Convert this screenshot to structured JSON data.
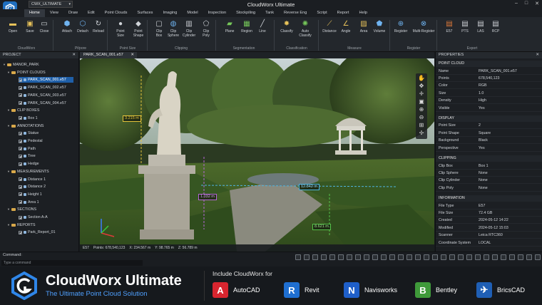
{
  "app": {
    "title": "CloudWorx Ultimate",
    "workspace": "CWX_ULTIMATE"
  },
  "menu": [
    "Home",
    "View",
    "Draw",
    "Edit",
    "Point Clouds",
    "Surfaces",
    "Imaging",
    "Model",
    "Inspection",
    "Stockpiling",
    "Tank",
    "Reverse Eng",
    "Script",
    "Report",
    "Help"
  ],
  "ribbon": {
    "buttons": [
      {
        "label": "Open",
        "icon": "folder-open-icon",
        "glyph": "▬"
      },
      {
        "label": "Save",
        "icon": "save-icon",
        "glyph": "▣"
      },
      {
        "label": "Close",
        "icon": "close-file-icon",
        "glyph": "▭"
      },
      {
        "label": "Attach",
        "icon": "attach-icon",
        "glyph": "⬢"
      },
      {
        "label": "Detach",
        "icon": "detach-icon",
        "glyph": "⬡"
      },
      {
        "label": "Reload",
        "icon": "reload-icon",
        "glyph": "↻"
      },
      {
        "label": "Point\nSize",
        "icon": "point-size-icon",
        "glyph": "●"
      },
      {
        "label": "Point\nShape",
        "icon": "point-shape-icon",
        "glyph": "◆"
      },
      {
        "label": "Clip\nBox",
        "icon": "clip-box-icon",
        "glyph": "▢"
      },
      {
        "label": "Clip\nSphere",
        "icon": "clip-sphere-icon",
        "glyph": "◍"
      },
      {
        "label": "Clip\nCylinder",
        "icon": "clip-cylinder-icon",
        "glyph": "▥"
      },
      {
        "label": "Clip\nPoly",
        "icon": "clip-poly-icon",
        "glyph": "⬠"
      },
      {
        "label": "Plane",
        "icon": "plane-icon",
        "glyph": "▰"
      },
      {
        "label": "Region",
        "icon": "region-icon",
        "glyph": "▦"
      },
      {
        "label": "Line",
        "icon": "line-icon",
        "glyph": "╱"
      },
      {
        "label": "Classify",
        "icon": "classify-icon",
        "glyph": "✸"
      },
      {
        "label": "Auto\nClassify",
        "icon": "auto-classify-icon",
        "glyph": "✺"
      },
      {
        "label": "Distance",
        "icon": "distance-icon",
        "glyph": "⟋"
      },
      {
        "label": "Angle",
        "icon": "angle-icon",
        "glyph": "∠"
      },
      {
        "label": "Area",
        "icon": "area-icon",
        "glyph": "▨"
      },
      {
        "label": "Volume",
        "icon": "volume-icon",
        "glyph": "⬟"
      },
      {
        "label": "Register",
        "icon": "register-icon",
        "glyph": "⊕"
      },
      {
        "label": "Multi-Register",
        "icon": "multi-register-icon",
        "glyph": "⊗"
      },
      {
        "label": "E57",
        "icon": "e57-file-icon",
        "glyph": "▤"
      },
      {
        "label": "PTS",
        "icon": "pts-file-icon",
        "glyph": "▤"
      },
      {
        "label": "LAS",
        "icon": "las-file-icon",
        "glyph": "▤"
      },
      {
        "label": "RCP",
        "icon": "rcp-file-icon",
        "glyph": "▤"
      }
    ],
    "groups": [
      "CloudWorx",
      "Pt/pore",
      "Point Size",
      "Clipping",
      "Segmentation",
      "Classification",
      "Measure",
      "Register",
      "Export"
    ]
  },
  "project": {
    "title": "PROJECT",
    "root": "MANOR_PARK",
    "folders": [
      {
        "name": "POINT CLOUDS",
        "items": [
          "PARK_SCAN_001.e57",
          "PARK_SCAN_002.e57",
          "PARK_SCAN_003.e57",
          "PARK_SCAN_004.e57"
        ]
      },
      {
        "name": "CLIP BOXES",
        "items": [
          "Box 1"
        ]
      },
      {
        "name": "ANNOTATIONS",
        "items": [
          "Statue",
          "Pedestal",
          "Path",
          "Tree",
          "Hedge"
        ]
      },
      {
        "name": "MEASUREMENTS",
        "items": [
          "Distance 1",
          "Distance 2",
          "Height 1",
          "Area 1"
        ]
      },
      {
        "name": "SECTIONS",
        "items": [
          "Section A-A"
        ]
      },
      {
        "name": "REPORTS",
        "items": [
          "Park_Report_01"
        ]
      }
    ]
  },
  "viewport": {
    "tab": "PARK_SCAN_001.e57",
    "measurements": [
      "3.215 m",
      "1.032 m",
      "12.842 m",
      "8.621 m"
    ],
    "status": {
      "format": "E57",
      "points": "Points: 678,540,123",
      "x": "X: 234.567 m",
      "y": "Y: 98.765 m",
      "z": "Z: 56.789 m"
    }
  },
  "properties": {
    "title": "PROPERTIES",
    "sections": [
      {
        "name": "POINT CLOUD",
        "rows": [
          [
            "Name",
            "PARK_SCAN_001.e57"
          ],
          [
            "Points",
            "678,540,123"
          ],
          [
            "Color",
            "RGB"
          ],
          [
            "Size",
            "1.0"
          ],
          [
            "Density",
            "High"
          ],
          [
            "Visible",
            "Yes"
          ]
        ]
      },
      {
        "name": "DISPLAY",
        "rows": [
          [
            "Point Size",
            "2"
          ],
          [
            "Point Shape",
            "Square"
          ],
          [
            "Background",
            "Black"
          ],
          [
            "Perspective",
            "Yes"
          ]
        ]
      },
      {
        "name": "CLIPPING",
        "rows": [
          [
            "Clip Box",
            "Box 1"
          ],
          [
            "Clip Sphere",
            "None"
          ],
          [
            "Clip Cylinder",
            "None"
          ],
          [
            "Clip Poly",
            "None"
          ]
        ]
      },
      {
        "name": "INFORMATION",
        "rows": [
          [
            "File Type",
            "E57"
          ],
          [
            "File Size",
            "72.4 GB"
          ],
          [
            "Created",
            "2024-05-12 14:22"
          ],
          [
            "Modified",
            "2024-05-12 15:03"
          ],
          [
            "Scanner",
            "Leica RTC360"
          ],
          [
            "Coordinate System",
            "LOCAL"
          ]
        ]
      }
    ]
  },
  "command": {
    "label": "Command:",
    "placeholder": "Type a command"
  },
  "banner": {
    "name": "CloudWorx Ultimate",
    "tagline": "The Ultimate Point Cloud Solution",
    "includes": "Include CloudWorx for",
    "products": [
      {
        "name": "AutoCAD",
        "letter": "A",
        "color": "#d8252f"
      },
      {
        "name": "Revit",
        "letter": "R",
        "color": "#1f6fd1"
      },
      {
        "name": "Navisworks",
        "letter": "N",
        "color": "#1f5fc9"
      },
      {
        "name": "Bentley",
        "letter": "B",
        "color": "#3f9a3a"
      },
      {
        "name": "BricsCAD",
        "letter": "✈",
        "color": "#1f5fb5"
      }
    ]
  },
  "colors": {
    "accent": "#1f6fbf",
    "selection": "#1f5fa8",
    "measure_yellow": "#e3c23a",
    "measure_purple": "#b466d8",
    "measure_cyan": "#4fb4e0",
    "measure_green": "#55c24a"
  }
}
